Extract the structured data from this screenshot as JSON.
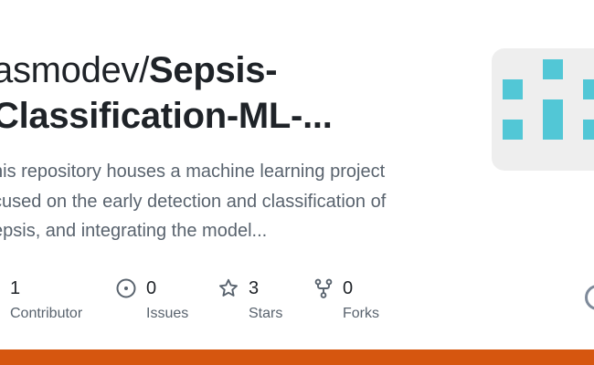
{
  "repo": {
    "owner": "asmodev/",
    "name_line1": "Sepsis-",
    "name_line2": "Classification-ML-...",
    "description_lines": [
      "his repository houses a machine learning project",
      "cused on the early detection and classification of",
      "epsis, and integrating the model..."
    ]
  },
  "stats": [
    {
      "icon": "contributors-icon",
      "value": "1",
      "label": "Contributor"
    },
    {
      "icon": "issues-icon",
      "value": "0",
      "label": "Issues"
    },
    {
      "icon": "star-icon",
      "value": "3",
      "label": "Stars"
    },
    {
      "icon": "fork-icon",
      "value": "0",
      "label": "Forks"
    }
  ],
  "colors": {
    "accent_bar": "#d6560f",
    "thumbnail_blocks": "#52c7d6",
    "thumbnail_background": "#eeeeee"
  }
}
